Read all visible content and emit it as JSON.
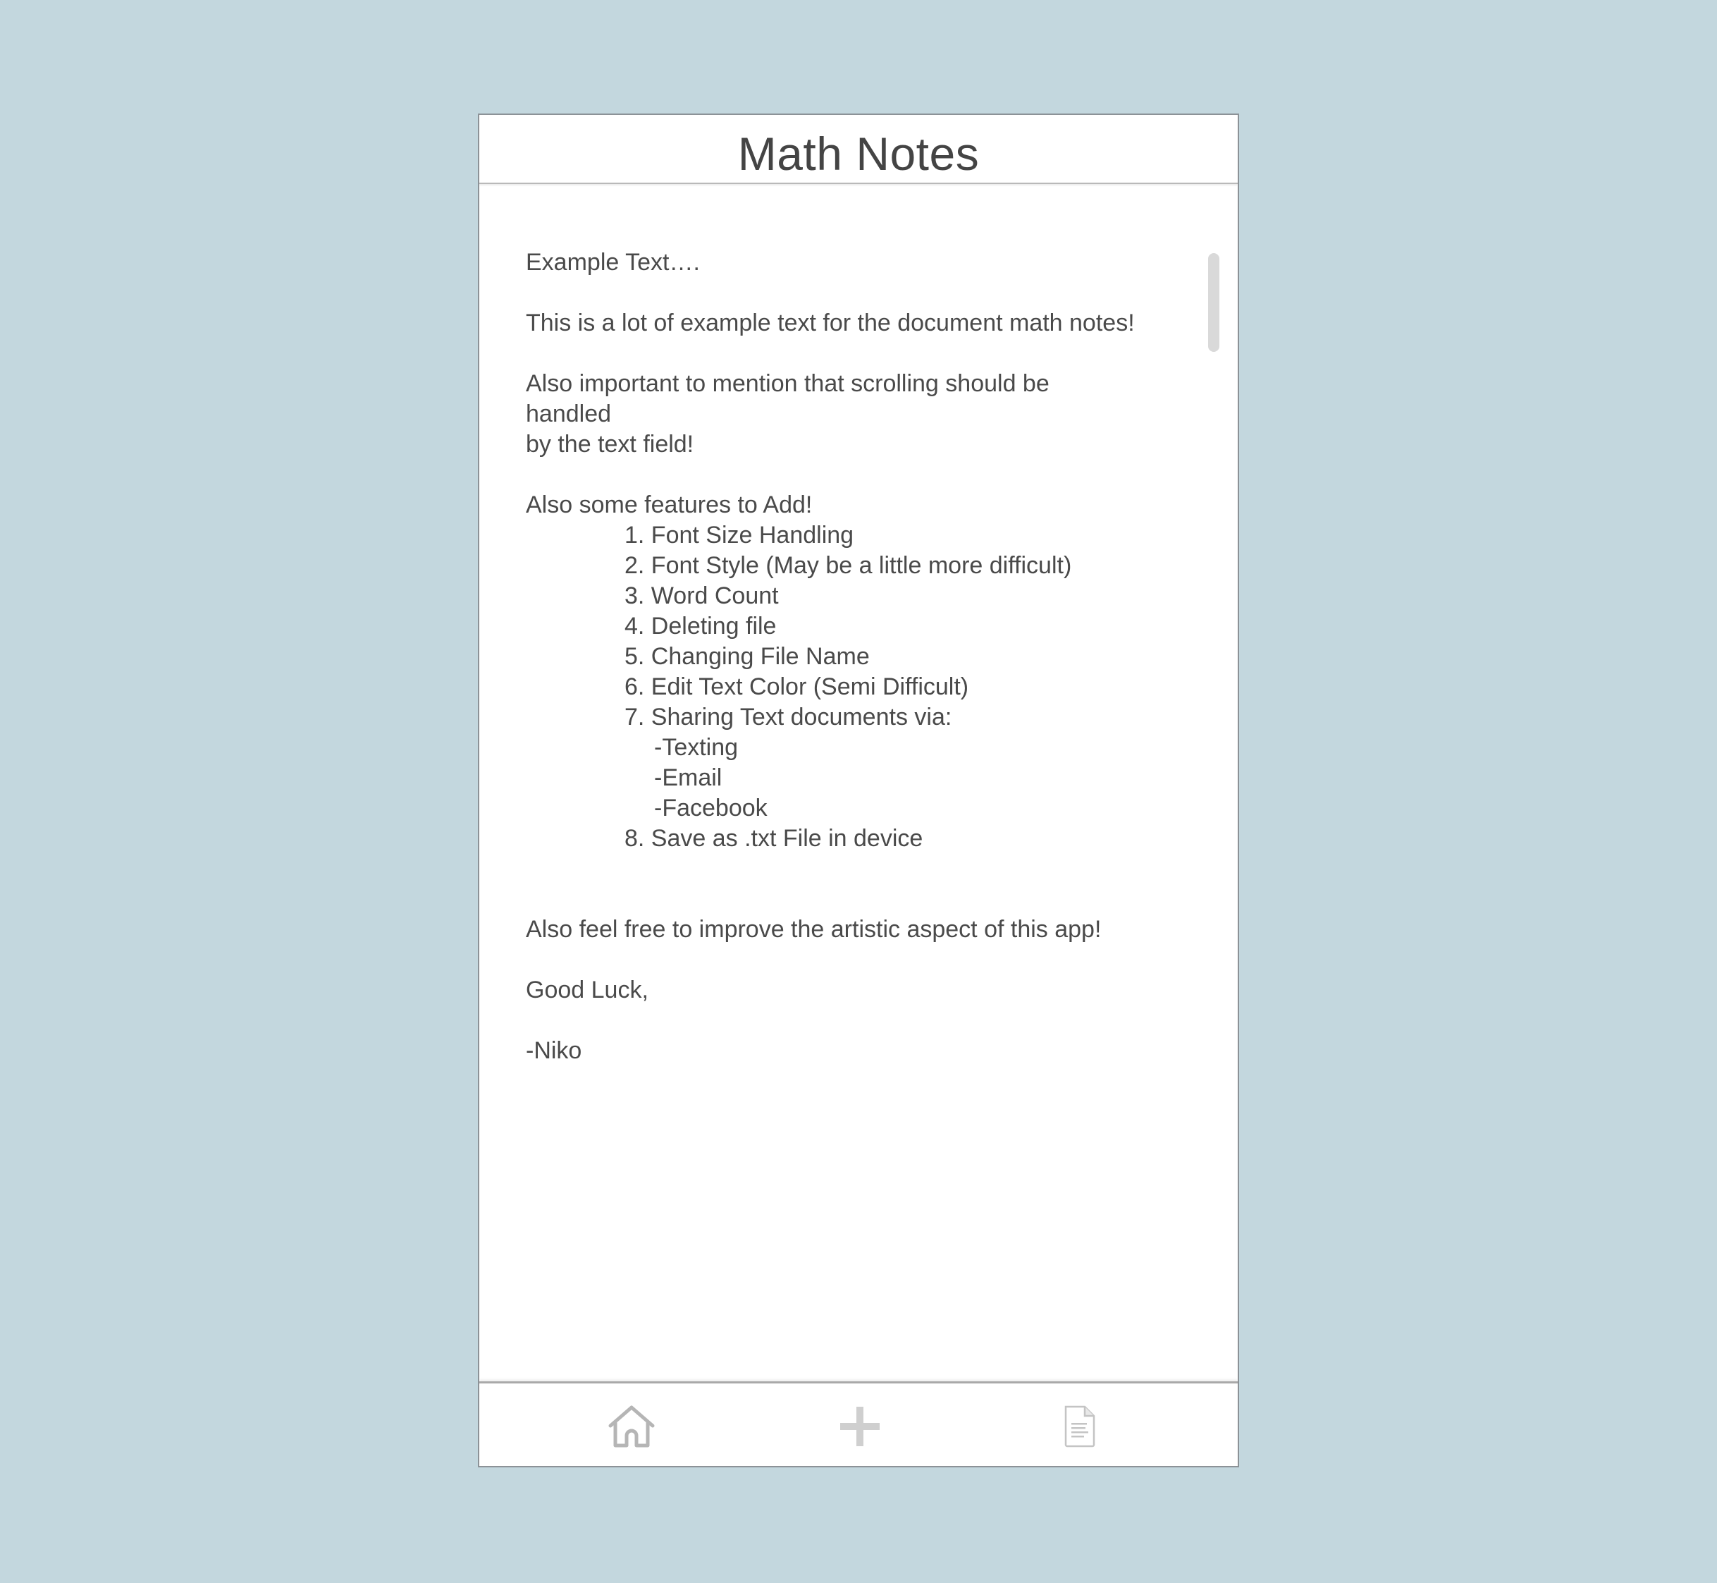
{
  "header": {
    "title": "Math Notes"
  },
  "document": {
    "heading_line": "Example Text….",
    "intro_line": "This is a lot of example text for the document math notes!",
    "scroll_note_lines": [
      "Also important to mention that scrolling should be",
      "handled",
      "by the text field!"
    ],
    "features_intro": "Also some features to Add!",
    "features": [
      "1. Font Size Handling",
      "2. Font Style (May be a little more difficult)",
      "3. Word Count",
      "4. Deleting file",
      "5. Changing File Name",
      "6. Edit Text Color (Semi Difficult)",
      "7. Sharing Text documents via:"
    ],
    "sharing_options": [
      "-Texting",
      "-Email",
      "-Facebook"
    ],
    "feature_8": "8. Save as .txt File in device",
    "closing_line": "Also feel free to improve the artistic aspect of this app!",
    "signoff": "Good Luck,",
    "signature": "-Niko"
  },
  "tab_bar": {
    "items": [
      {
        "icon": "home-icon"
      },
      {
        "icon": "plus-icon"
      },
      {
        "icon": "document-icon"
      }
    ]
  },
  "colors": {
    "background": "#c3d7de",
    "text": "#4a4a4a",
    "icon": "#b5b5b5"
  }
}
